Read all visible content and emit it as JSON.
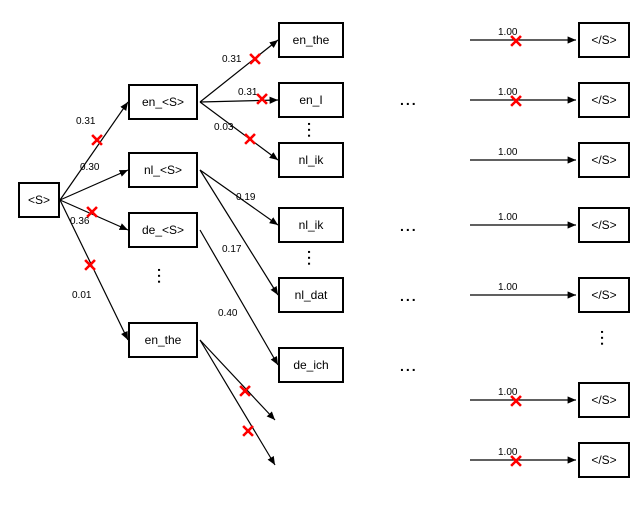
{
  "root": {
    "label": "<S>"
  },
  "level1": {
    "n0": {
      "label": "en_<S>",
      "prob": "0.31",
      "pruned": false
    },
    "n1": {
      "label": "nl_<S>",
      "prob": "0.30",
      "pruned": true
    },
    "n2": {
      "label": "de_<S>",
      "prob": "0.36",
      "pruned": true
    },
    "n3": {
      "label": "en_the",
      "prob": "0.01",
      "pruned": true
    }
  },
  "level2": {
    "from_en": {
      "e0": {
        "label": "en_the",
        "prob": "0.31",
        "pruned": true
      },
      "e1": {
        "label": "en_I",
        "prob": "0.31",
        "pruned": true
      },
      "e2": {
        "label": "nl_ik",
        "prob": "0.03",
        "pruned": true
      }
    },
    "from_nl": {
      "n0": {
        "label": "nl_ik",
        "prob": "0.19",
        "pruned": false
      },
      "n1": {
        "label": "nl_dat",
        "prob": "0.17",
        "pruned": false
      }
    },
    "from_de": {
      "d0": {
        "label": "de_ich",
        "prob": "0.40",
        "pruned": false
      }
    },
    "from_en_the": {
      "t0": {
        "pruned": true
      },
      "t1": {
        "pruned": true
      }
    }
  },
  "terminal": {
    "label": "</S>",
    "prob": "1.00",
    "rows": [
      {
        "pruned": true
      },
      {
        "pruned": true
      },
      {
        "pruned": false
      },
      {
        "pruned": false
      },
      {
        "pruned": false
      },
      {
        "pruned": true
      },
      {
        "pruned": true
      }
    ]
  },
  "ellipsis": "..."
}
